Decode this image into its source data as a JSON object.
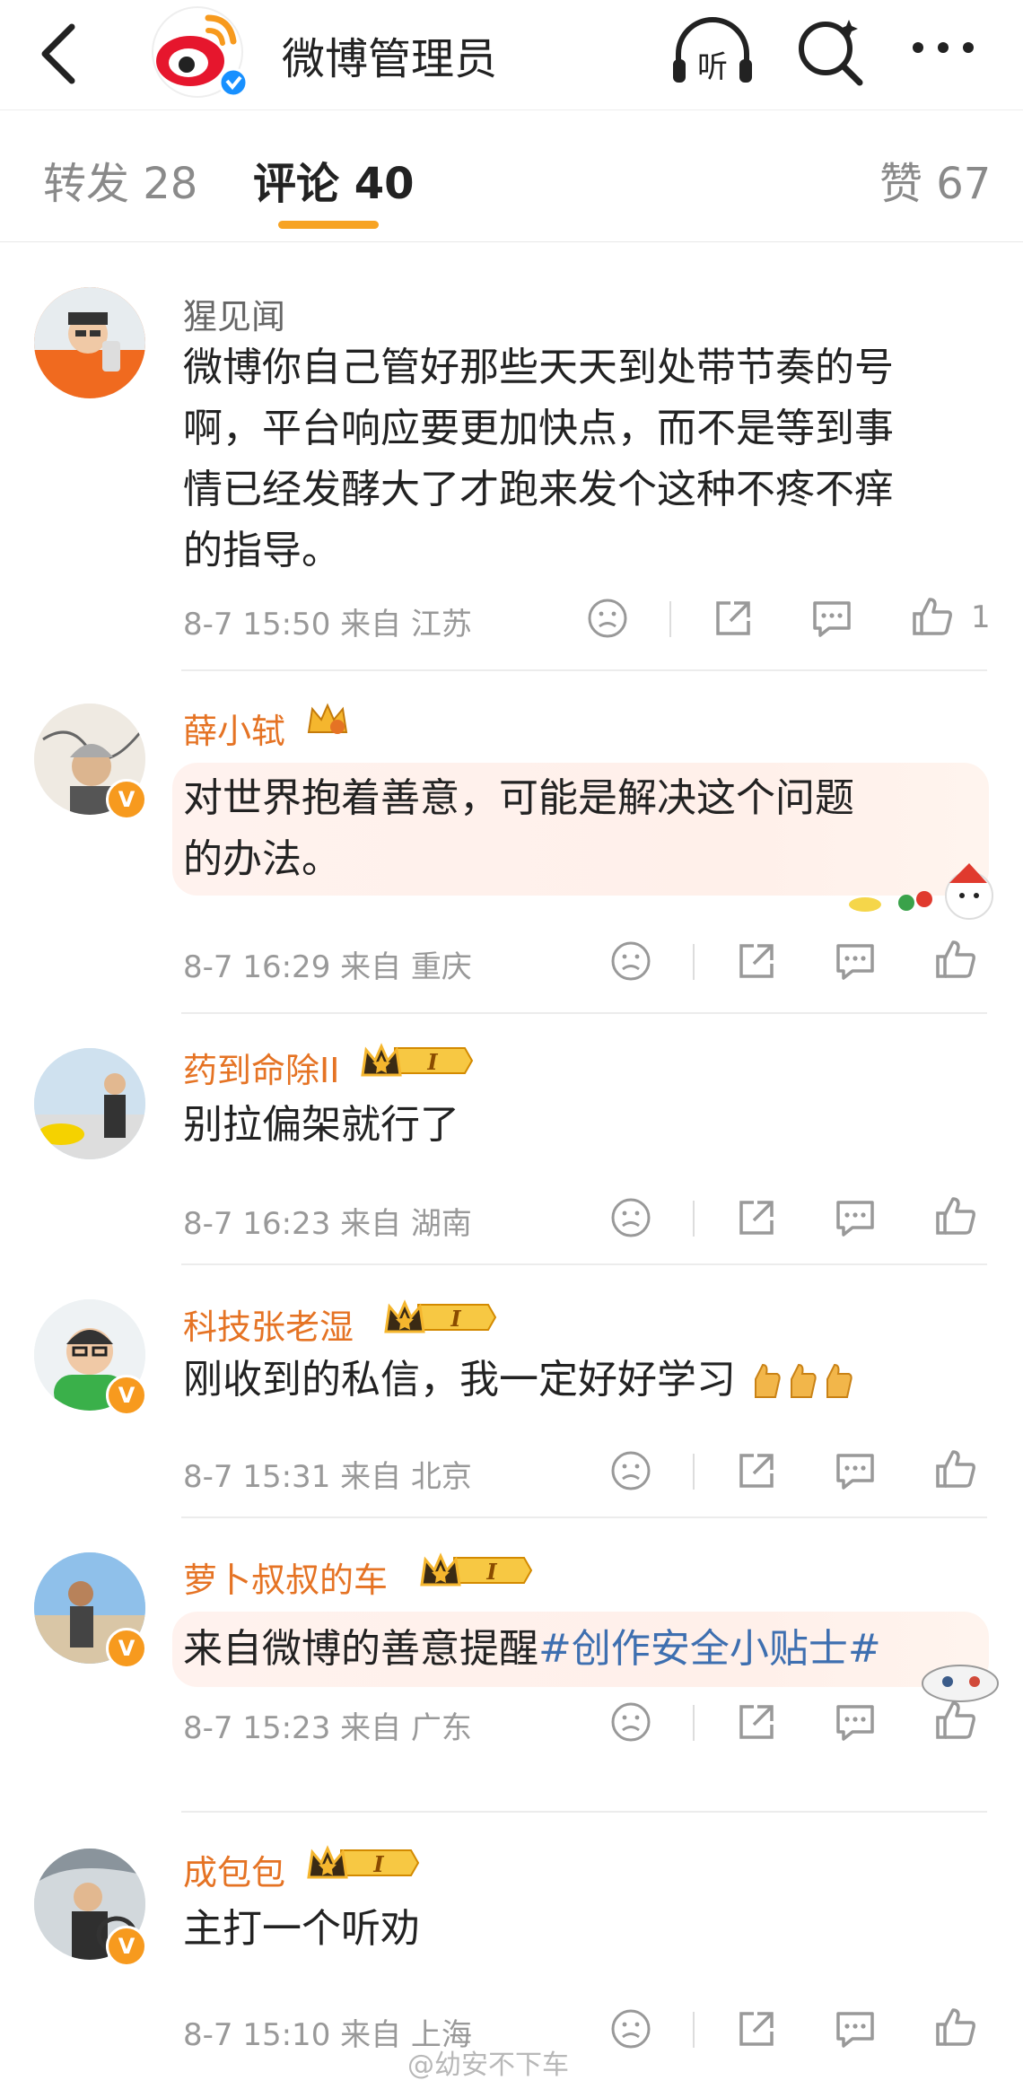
{
  "nav": {
    "title": "微博管理员",
    "listen_icon_text": "听"
  },
  "tabs": {
    "repost": "转发 28",
    "comment": "评论 40",
    "like": "赞 67"
  },
  "colors": {
    "accent": "#f7a323",
    "name_orange": "#e57324",
    "hashtag_blue": "#3e6fb0",
    "verified_badge": "#f79a1e"
  },
  "comments": [
    {
      "name": "猩见闻",
      "text": "微博你自己管好那些天天到处带节奏的号啊，平台响应要更加快点，而不是等到事情已经发酵大了才跑来发个这种不疼不痒的指导。",
      "lines": [
        "微博你自己管好那些天天到处带节奏的号",
        "啊，平台响应要更加快点，而不是等到事",
        "情已经发酵大了才跑来发个这种不疼不痒",
        "的指导。"
      ],
      "meta": "8-7 15:50 来自 江苏",
      "likes": "1"
    },
    {
      "name": "薛小轼",
      "lines": [
        "对世界抱着善意，可能是解决这个问题",
        "的办法。"
      ],
      "meta": "8-7 16:29 来自 重庆",
      "verified": "V"
    },
    {
      "name": "药到命除II",
      "lines": [
        "别拉偏架就行了"
      ],
      "meta": "8-7 16:23 来自 湖南",
      "level": "I"
    },
    {
      "name": "科技张老湿",
      "lines": [
        "刚收到的私信，我一定好好学习"
      ],
      "meta": "8-7 15:31 来自 北京",
      "level": "I",
      "verified": "V"
    },
    {
      "name": "萝卜叔叔的车",
      "text_plain": "来自微博的善意提醒",
      "hashtag": "#创作安全小贴士#",
      "meta": "8-7 15:23 来自 广东",
      "level": "I",
      "verified": "V"
    },
    {
      "name": "成包包",
      "lines": [
        "主打一个听劝"
      ],
      "meta": "8-7 15:10 来自 上海",
      "level": "I",
      "verified": "V"
    }
  ],
  "watermark": "@幼安不下车",
  "icons": [
    "back-arrow-icon",
    "weibo-logo-icon",
    "listen-icon",
    "search-icon",
    "more-icon",
    "dislike-face-icon",
    "share-icon",
    "comment-icon",
    "thumbs-up-icon",
    "crown-badge-icon",
    "thumbs-up-emoji-icon"
  ]
}
